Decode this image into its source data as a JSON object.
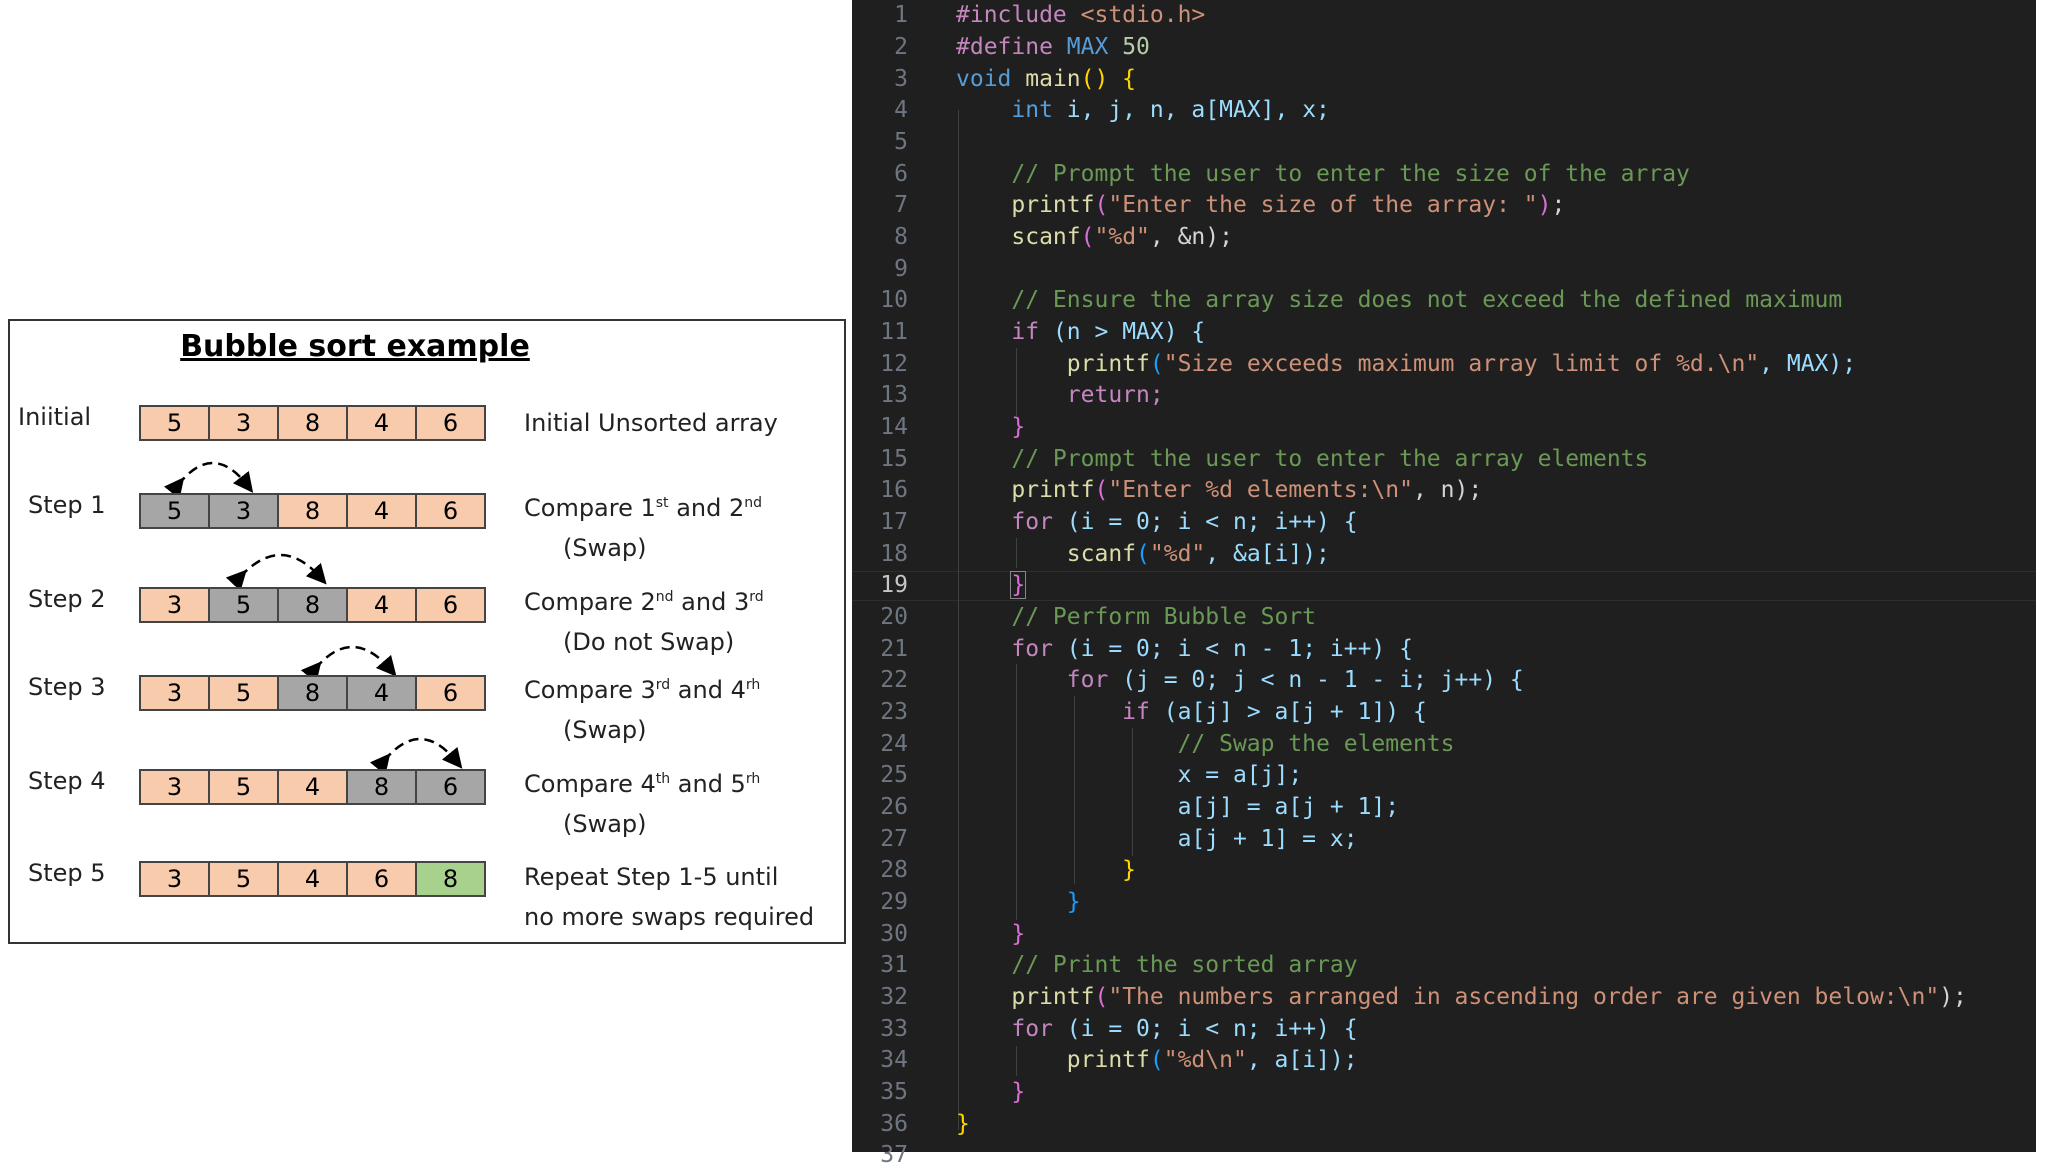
{
  "diagram": {
    "title": "Bubble sort example",
    "rows": [
      {
        "label": "Iniitial",
        "values": [
          "5",
          "3",
          "8",
          "4",
          "6"
        ],
        "colors": [
          "o",
          "o",
          "o",
          "o",
          "o"
        ],
        "desc_main": "Initial Unsorted array",
        "desc_sub": ""
      },
      {
        "label": "Step 1",
        "values": [
          "5",
          "3",
          "8",
          "4",
          "6"
        ],
        "colors": [
          "g",
          "g",
          "o",
          "o",
          "o"
        ],
        "desc_pre": "Compare 1",
        "sup1": "st",
        "desc_mid": " and 2",
        "sup2": "nd",
        "desc_sub": "(Swap)"
      },
      {
        "label": "Step 2",
        "values": [
          "3",
          "5",
          "8",
          "4",
          "6"
        ],
        "colors": [
          "o",
          "g",
          "g",
          "o",
          "o"
        ],
        "desc_pre": "Compare 2",
        "sup1": "nd",
        "desc_mid": " and 3",
        "sup2": "rd",
        "desc_sub": "(Do not Swap)"
      },
      {
        "label": "Step 3",
        "values": [
          "3",
          "5",
          "8",
          "4",
          "6"
        ],
        "colors": [
          "o",
          "o",
          "g",
          "g",
          "o"
        ],
        "desc_pre": "Compare 3",
        "sup1": "rd",
        "desc_mid": " and 4",
        "sup2": "rh",
        "desc_sub": "(Swap)"
      },
      {
        "label": "Step 4",
        "values": [
          "3",
          "5",
          "4",
          "8",
          "6"
        ],
        "colors": [
          "o",
          "o",
          "o",
          "g",
          "g"
        ],
        "desc_pre": "Compare 4",
        "sup1": "th",
        "desc_mid": " and 5",
        "sup2": "rh",
        "desc_sub": "(Swap)"
      },
      {
        "label": "Step 5",
        "values": [
          "3",
          "5",
          "4",
          "6",
          "8"
        ],
        "colors": [
          "o",
          "o",
          "o",
          "o",
          "gr"
        ],
        "desc_main": "Repeat  Step 1-5 until",
        "desc_sub2": "no more swaps required"
      }
    ],
    "colors": {
      "orange": "#f8cbad",
      "gray": "#a6a6a6",
      "green": "#a9d18e"
    }
  },
  "editor": {
    "line_numbers": [
      "1",
      "2",
      "3",
      "4",
      "5",
      "6",
      "7",
      "8",
      "9",
      "10",
      "11",
      "12",
      "13",
      "14",
      "15",
      "16",
      "17",
      "18",
      "19",
      "20",
      "21",
      "22",
      "23",
      "24",
      "25",
      "26",
      "27",
      "28",
      "29",
      "30",
      "31",
      "32",
      "33",
      "34",
      "35",
      "36",
      "37"
    ],
    "current_line": "19",
    "code": {
      "l1_pp": "#include",
      "l1_hdr": "<stdio.h>",
      "l2_pp": "#define",
      "l2_name": "MAX",
      "l2_val": "50",
      "l3_kw": "void",
      "l3_fn": "main",
      "l3_rest": "() {",
      "l4_kw": "int",
      "l4_rest": "i, j, n, a[MAX], x;",
      "l6": "// Prompt the user to enter the size of the array",
      "l7_fn": "printf",
      "l7_str": "\"Enter the size of the array: \"",
      "l8_fn": "scanf",
      "l8_str": "\"%d\"",
      "l8_rest": ", &n);",
      "l10": "// Ensure the array size does not exceed the defined maximum",
      "l11_kw": "if",
      "l11_rest": "(n > MAX) {",
      "l12_fn": "printf",
      "l12_str": "\"Size exceeds maximum array limit of %d.\\n\"",
      "l12_rest": ", MAX);",
      "l13": "return;",
      "l14": "}",
      "l15": "// Prompt the user to enter the array elements",
      "l16_fn": "printf",
      "l16_str": "\"Enter %d elements:\\n\"",
      "l16_rest": ", n);",
      "l17_kw": "for",
      "l17_rest": "(i = 0; i < n; i++) {",
      "l18_fn": "scanf",
      "l18_str": "\"%d\"",
      "l18_rest": ", &a[i]);",
      "l19": "}",
      "l20": "// Perform Bubble Sort",
      "l21_kw": "for",
      "l21_rest": "(i = 0; i < n - 1; i++) {",
      "l22_kw": "for",
      "l22_rest": "(j = 0; j < n - 1 - i; j++) {",
      "l23_kw": "if",
      "l23_rest": "(a[j] > a[j + 1]) {",
      "l24": "// Swap the elements",
      "l25": "x = a[j];",
      "l26": "a[j] = a[j + 1];",
      "l27": "a[j + 1] = x;",
      "l28": "}",
      "l29": "}",
      "l30": "}",
      "l31": "// Print the sorted array",
      "l32_fn": "printf",
      "l32_str": "\"The numbers arranged in ascending order are given below:\\n\"",
      "l32_rest": ");",
      "l33_kw": "for",
      "l33_rest": "(i = 0; i < n; i++) {",
      "l34_fn": "printf",
      "l34_str": "\"%d\\n\"",
      "l34_rest": ", a[i]);",
      "l35": "}",
      "l36": "}"
    }
  }
}
